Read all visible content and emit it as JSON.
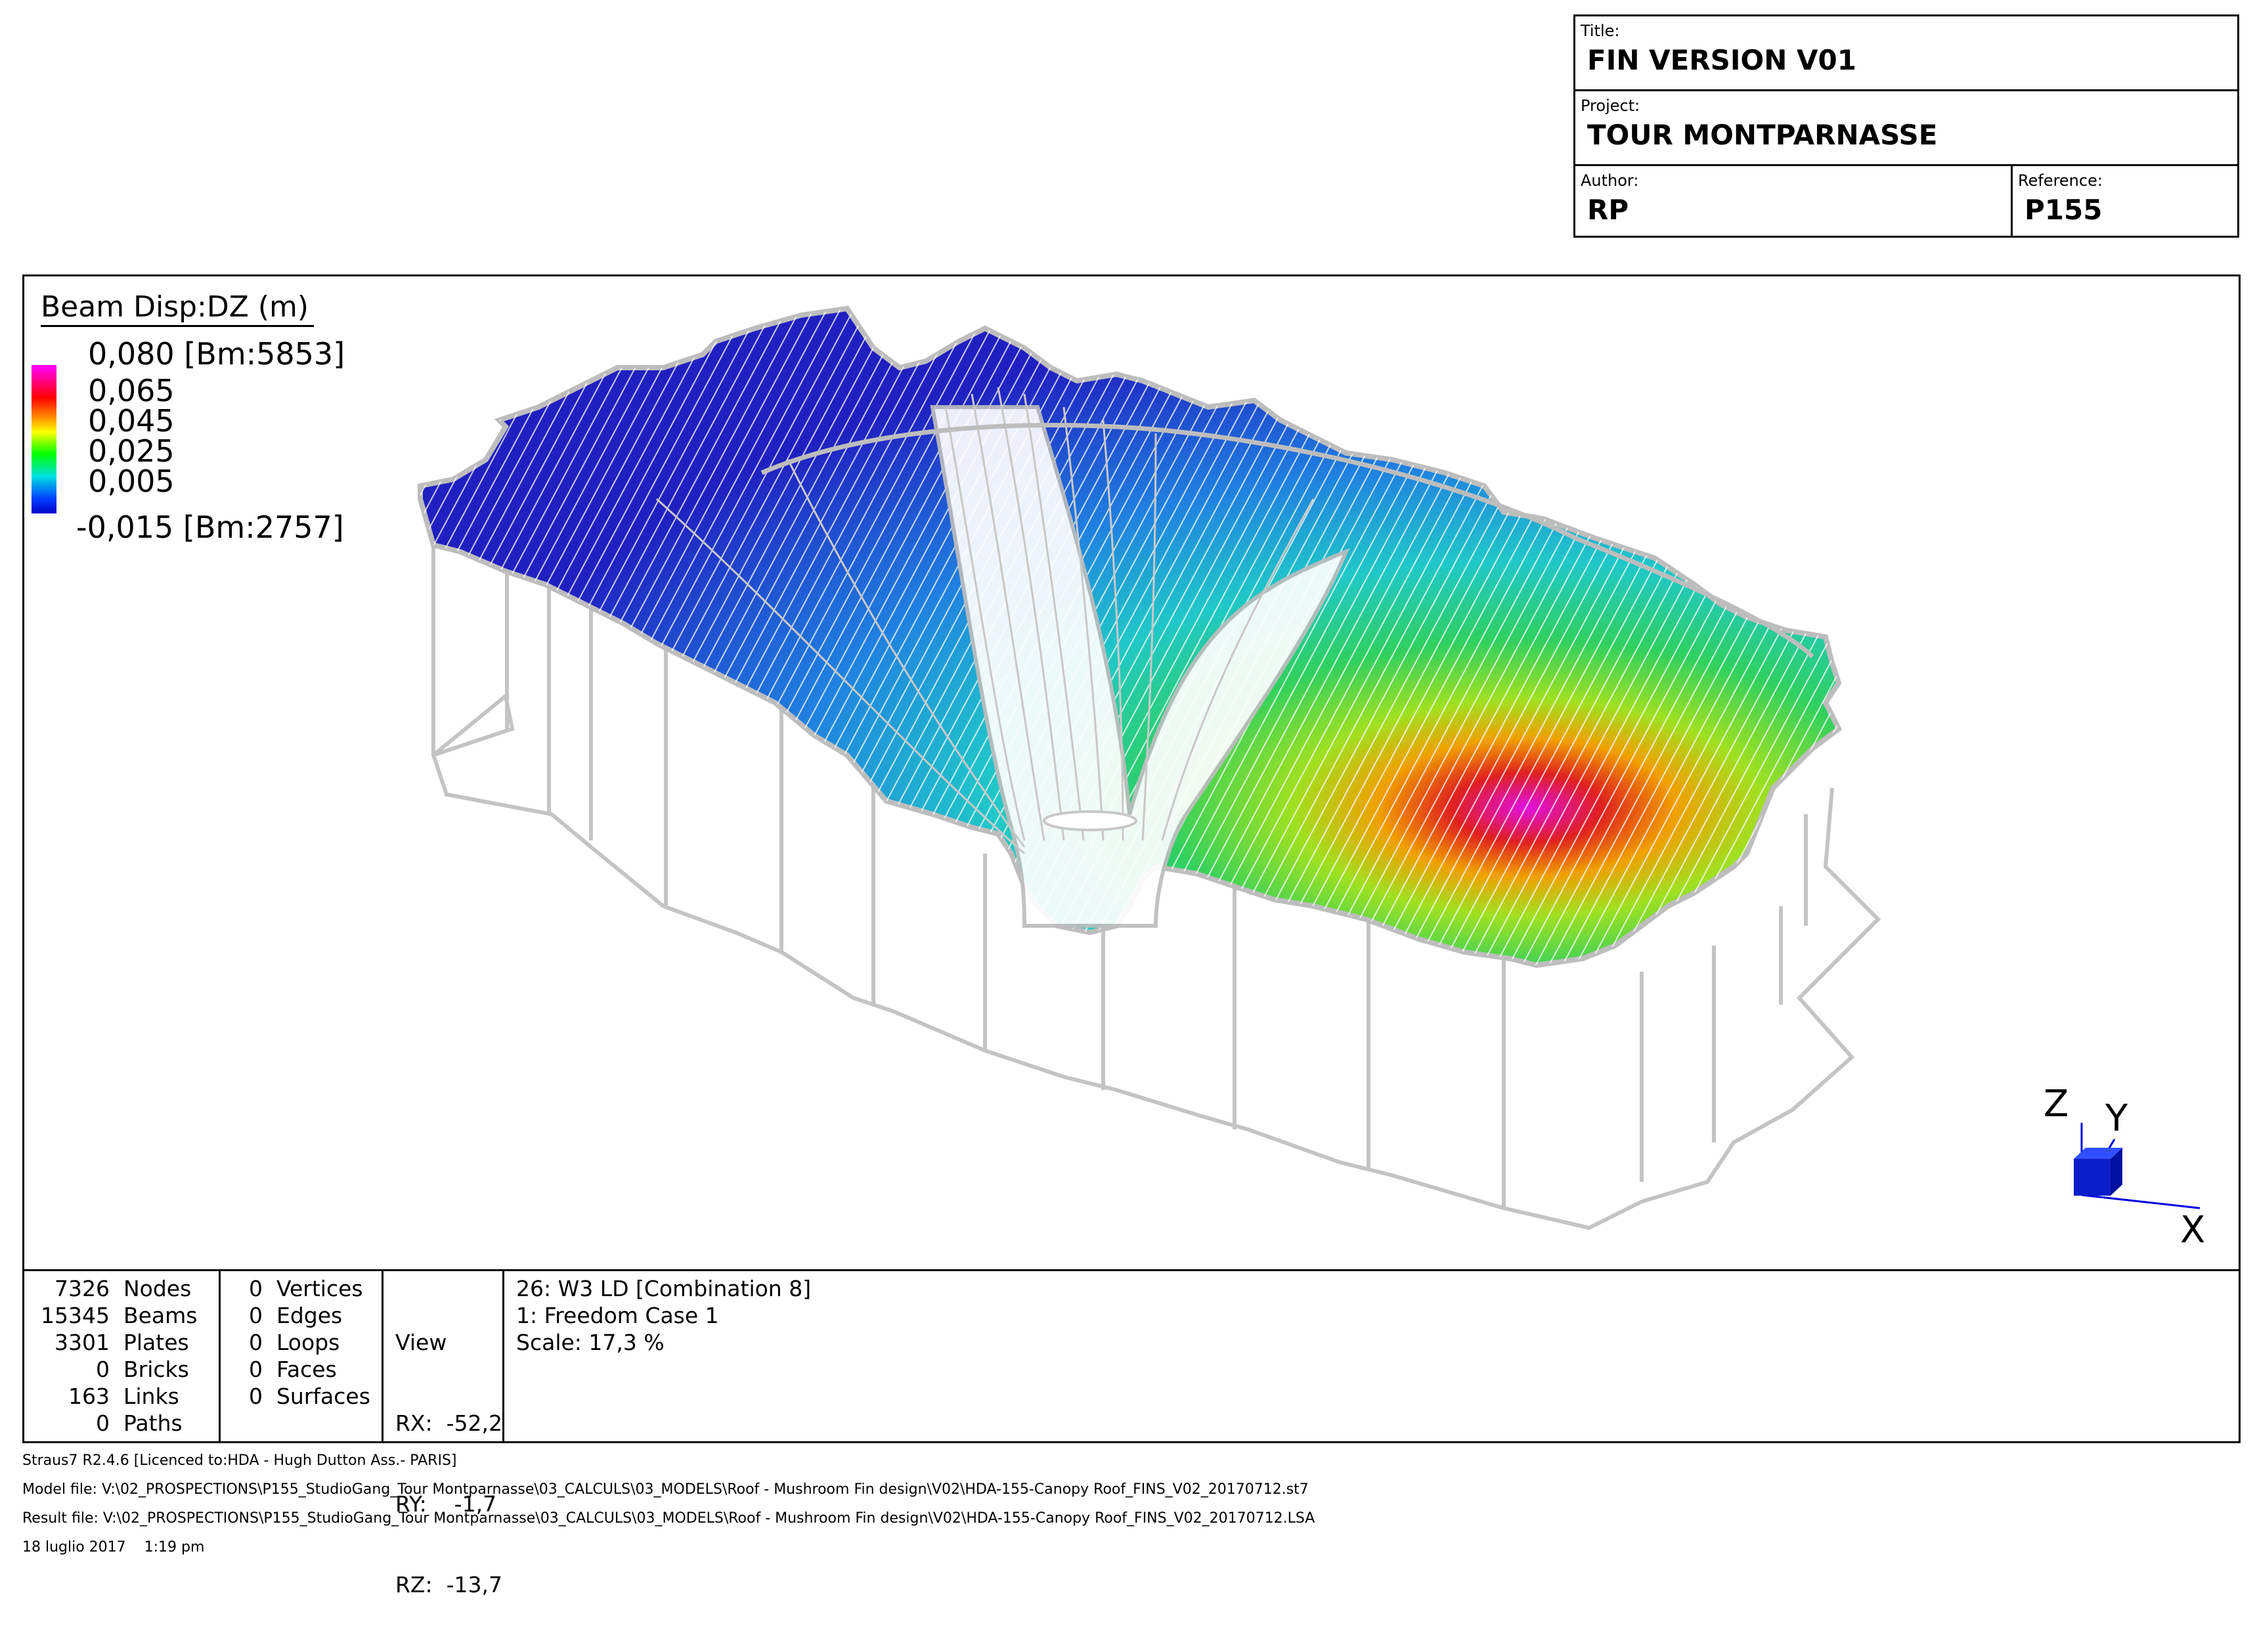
{
  "title_block": {
    "title_label": "Title:",
    "title": "FIN VERSION V01",
    "project_label": "Project:",
    "project": "TOUR MONTPARNASSE",
    "author_label": "Author:",
    "author": "RP",
    "reference_label": "Reference:",
    "reference": "P155"
  },
  "legend": {
    "title": "Beam Disp:DZ  (m)",
    "max": "0,080 [Bm:5853]",
    "ticks": [
      "0,065",
      "0,045",
      "0,025",
      "0,005"
    ],
    "min": "-0,015 [Bm:2757]",
    "colors": [
      "#ff00ff",
      "#ff0000",
      "#ff8000",
      "#ffff00",
      "#00ff00",
      "#00e0e0",
      "#0040ff",
      "#0000c8"
    ]
  },
  "axes": {
    "z": "Z",
    "y": "Y",
    "x": "X"
  },
  "stats": {
    "entities": [
      {
        "count": "7326",
        "label": "Nodes"
      },
      {
        "count": "15345",
        "label": "Beams"
      },
      {
        "count": "3301",
        "label": "Plates"
      },
      {
        "count": "0",
        "label": "Bricks"
      },
      {
        "count": "163",
        "label": "Links"
      },
      {
        "count": "0",
        "label": "Paths"
      }
    ],
    "geometry": [
      {
        "count": "0",
        "label": "Vertices"
      },
      {
        "count": "0",
        "label": "Edges"
      },
      {
        "count": "0",
        "label": "Loops"
      },
      {
        "count": "0",
        "label": "Faces"
      },
      {
        "count": "0",
        "label": "Surfaces"
      }
    ]
  },
  "view": {
    "heading": "View",
    "rx": "RX:  -52,2",
    "ry": "RY:    -1,7",
    "rz": "RZ:  -13,7"
  },
  "load_case": {
    "combination": "26: W3 LD [Combination 8]",
    "freedom": "1: Freedom Case 1",
    "scale": "Scale: 17,3 %"
  },
  "footer": {
    "licence": "Straus7 R2.4.6 [Licenced to:HDA - Hugh Dutton Ass.- PARIS]",
    "model_file": "Model file: V:\\02_PROSPECTIONS\\P155_StudioGang_Tour Montparnasse\\03_CALCULS\\03_MODELS\\Roof - Mushroom Fin design\\V02\\HDA-155-Canopy Roof_FINS_V02_20170712.st7",
    "result_file": "Result file: V:\\02_PROSPECTIONS\\P155_StudioGang_Tour Montparnasse\\03_CALCULS\\03_MODELS\\Roof - Mushroom Fin design\\V02\\HDA-155-Canopy Roof_FINS_V02_20170712.LSA",
    "timestamp": "18 luglio 2017    1:19 pm"
  }
}
